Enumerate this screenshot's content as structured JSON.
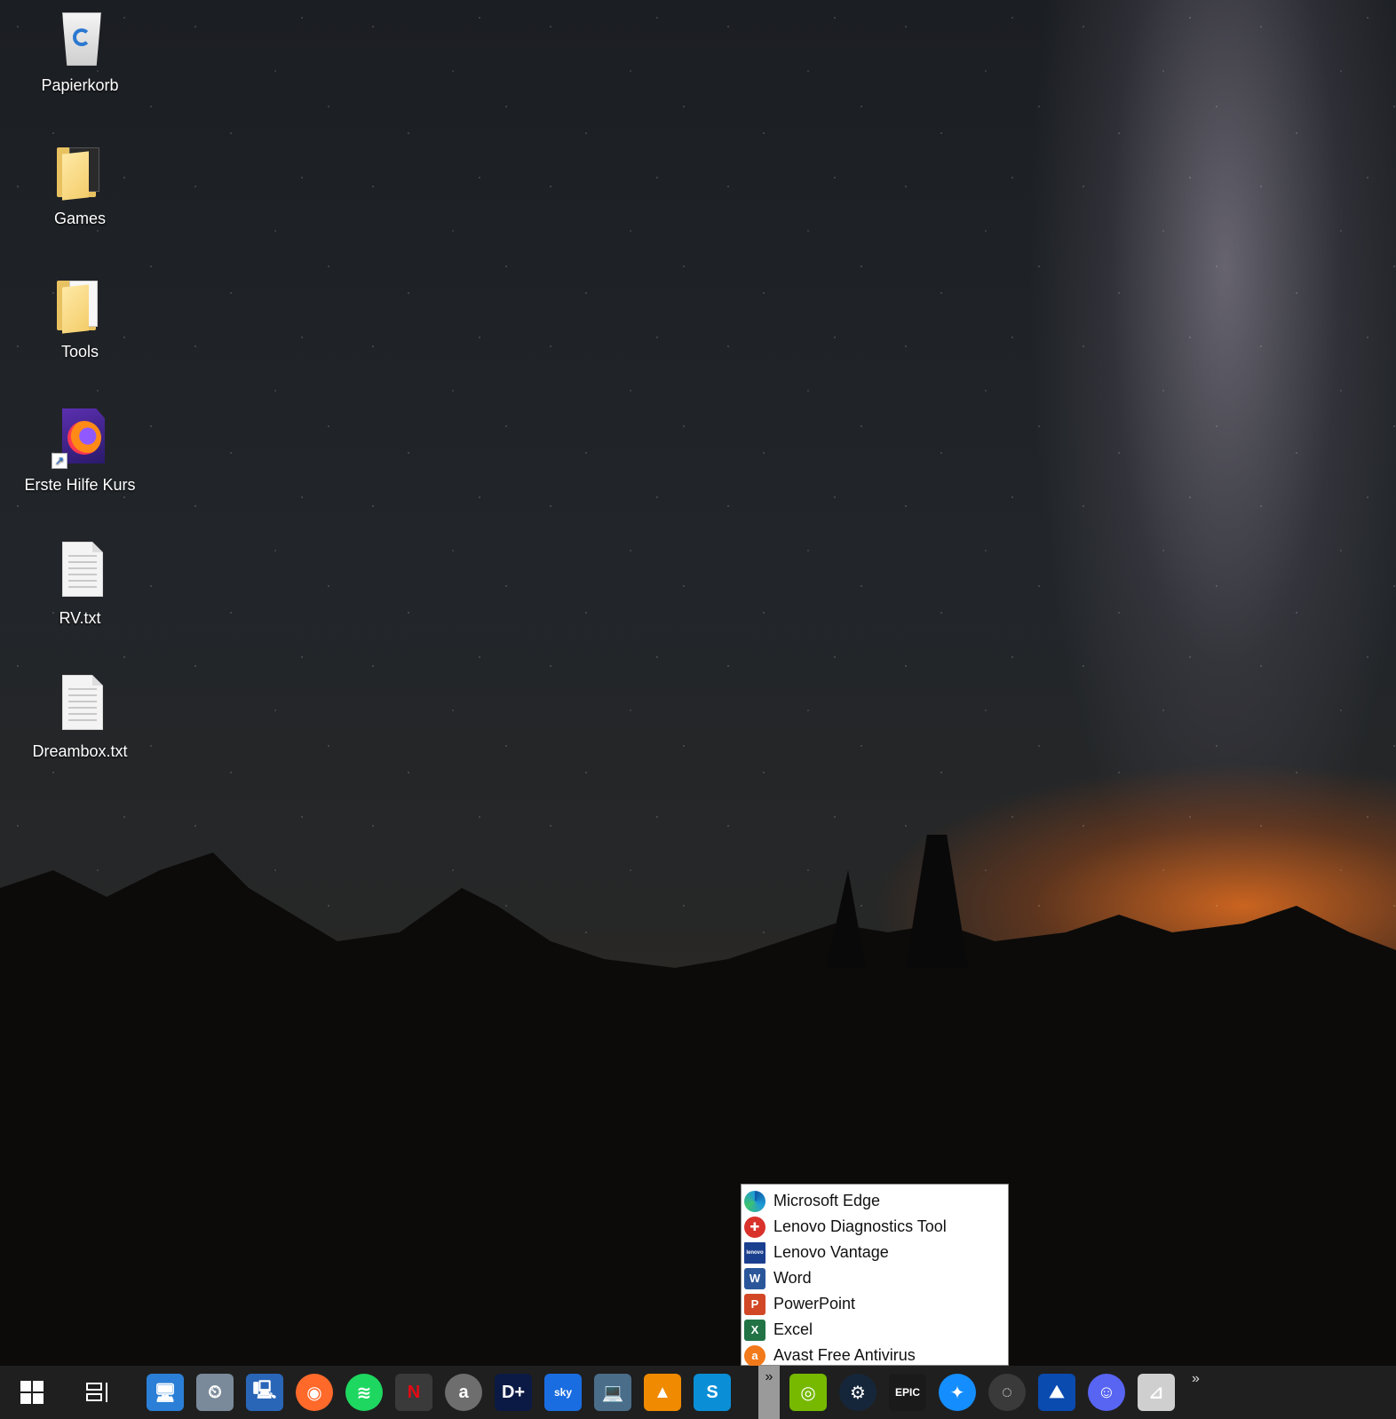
{
  "desktop": {
    "icons": [
      {
        "label": "Papierkorb",
        "icon": "recycle-bin-icon"
      },
      {
        "label": "Games",
        "icon": "folder-icon"
      },
      {
        "label": "Tools",
        "icon": "folder-icon"
      },
      {
        "label": "Erste Hilfe Kurs",
        "icon": "firefox-shortcut-icon"
      },
      {
        "label": "RV.txt",
        "icon": "text-file-icon"
      },
      {
        "label": "Dreambox.txt",
        "icon": "text-file-icon"
      }
    ]
  },
  "overflow_menu": {
    "items": [
      {
        "label": "Microsoft Edge",
        "icon": "edge-icon",
        "color": "#1f9bd7"
      },
      {
        "label": "Lenovo Diagnostics Tool",
        "icon": "lenovo-diagnostics-icon",
        "color": "#d8322b"
      },
      {
        "label": "Lenovo Vantage",
        "icon": "lenovo-vantage-icon",
        "color": "#1b3f8f"
      },
      {
        "label": "Word",
        "icon": "word-icon",
        "color": "#2b579a"
      },
      {
        "label": "PowerPoint",
        "icon": "powerpoint-icon",
        "color": "#d24726"
      },
      {
        "label": "Excel",
        "icon": "excel-icon",
        "color": "#217346"
      },
      {
        "label": "Avast Free Antivirus",
        "icon": "avast-icon",
        "color": "#f27a1a"
      }
    ]
  },
  "taskbar": {
    "overflow_glyph": "»",
    "tray_glyph": "»",
    "pinned": [
      {
        "name": "this-pc-icon",
        "glyph": "🖥",
        "color": "#2b7fd6"
      },
      {
        "name": "time-machine-icon",
        "glyph": "⏲",
        "color": "#7a8a9a"
      },
      {
        "name": "network-icon",
        "glyph": "🖳",
        "color": "#2a66b8"
      },
      {
        "name": "firefox-icon",
        "glyph": "◉",
        "color": "#ff6a2b"
      },
      {
        "name": "spotify-icon",
        "glyph": "≋",
        "color": "#1ed760"
      },
      {
        "name": "netflix-icon",
        "glyph": "N",
        "color": "#3a3a3a"
      },
      {
        "name": "amazon-icon",
        "glyph": "a",
        "color": "#6e6e6e"
      },
      {
        "name": "disney-plus-icon",
        "glyph": "D+",
        "color": "#0b1a45"
      },
      {
        "name": "sky-icon",
        "glyph": "sky",
        "color": "#1a6de0"
      },
      {
        "name": "laptop-icon",
        "glyph": "💻",
        "color": "#4a6d8a"
      },
      {
        "name": "vlc-icon",
        "glyph": "▲",
        "color": "#f08a00"
      },
      {
        "name": "skype-icon",
        "glyph": "S",
        "color": "#0a8fd6"
      }
    ],
    "pinned_right": [
      {
        "name": "nvidia-icon",
        "glyph": "◎",
        "color": "#76b900"
      },
      {
        "name": "steam-icon",
        "glyph": "⚙",
        "color": "#16263a"
      },
      {
        "name": "epic-games-icon",
        "glyph": "EPIC",
        "color": "#1a1a1a"
      },
      {
        "name": "battlenet-icon",
        "glyph": "✦",
        "color": "#148eff"
      },
      {
        "name": "ubisoft-icon",
        "glyph": "◌",
        "color": "#3a3a3a"
      },
      {
        "name": "playstation-remote-icon",
        "glyph": "⛰",
        "color": "#0a4bb0"
      },
      {
        "name": "discord-icon",
        "glyph": "☺",
        "color": "#5865f2"
      },
      {
        "name": "controller-icon",
        "glyph": "⊿",
        "color": "#cfcfcf"
      }
    ]
  }
}
